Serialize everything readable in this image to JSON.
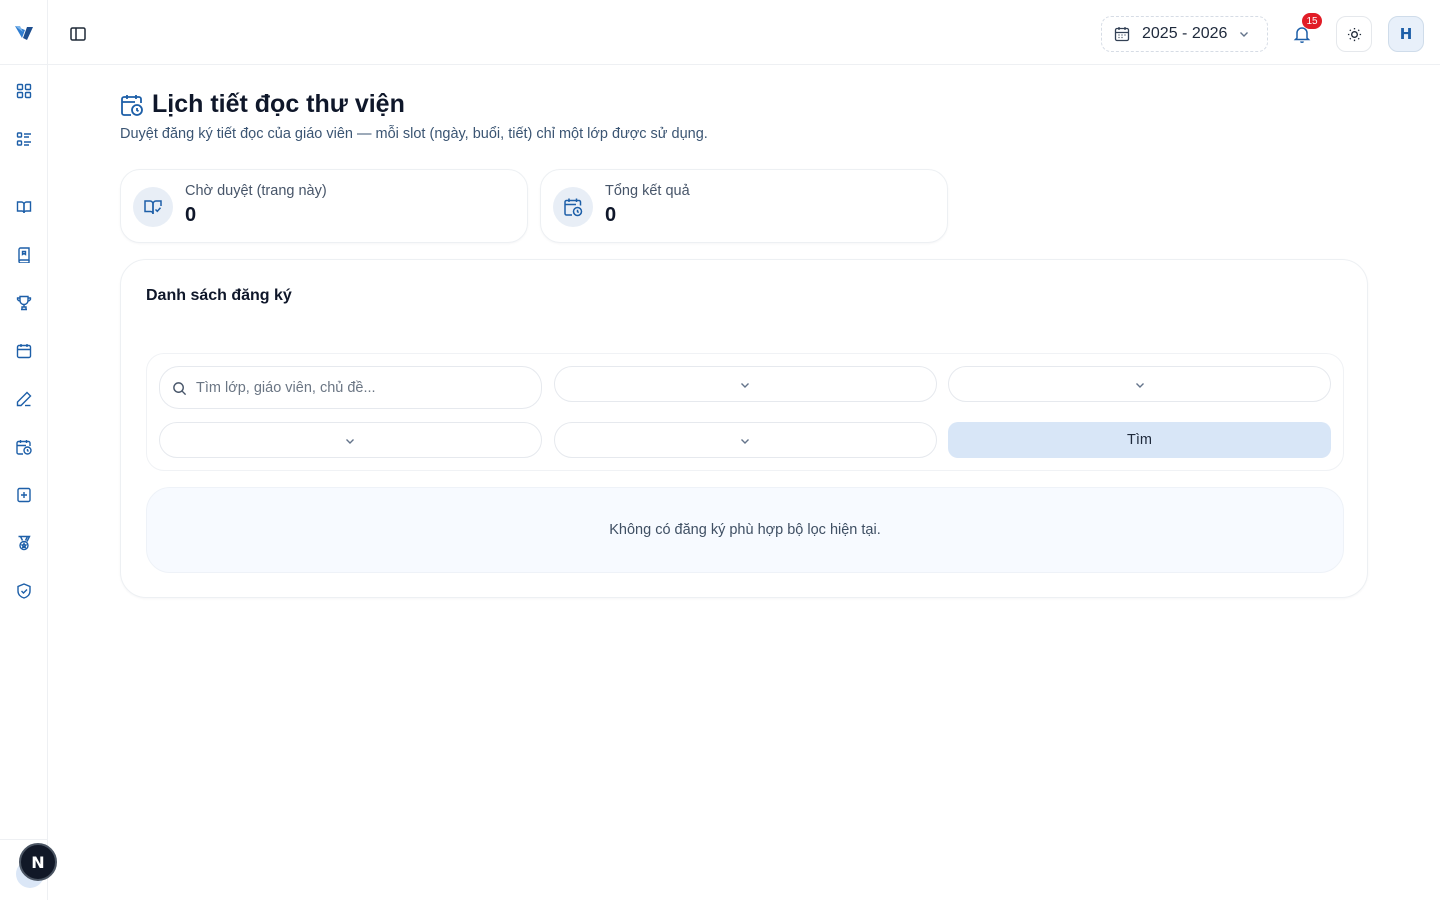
{
  "header": {
    "school_year": "2025 - 2026",
    "notification_count": "15",
    "user_initial": "H"
  },
  "page": {
    "title": "Lịch tiết đọc thư viện",
    "subtitle": "Duyệt đăng ký tiết đọc của giáo viên — mỗi slot (ngày, buổi, tiết) chỉ một lớp được sử dụng."
  },
  "stats": [
    {
      "label": "Chờ duyệt (trang này)",
      "value": "0",
      "icon": "book-check-icon"
    },
    {
      "label": "Tổng kết quả",
      "value": "0",
      "icon": "calendar-clock-icon"
    }
  ],
  "list": {
    "title": "Danh sách đăng ký",
    "search_placeholder": "Tìm lớp, giáo viên, chủ đề...",
    "search_button": "Tìm",
    "empty_message": "Không có đăng ký phù hợp bộ lọc hiện tại."
  },
  "sidebar": {
    "icons": [
      "dashboard-icon",
      "list-icon",
      "book-open-icon",
      "book-icon",
      "trophy-icon",
      "calendar-icon",
      "pen-icon",
      "calendar-clock-icon",
      "book-plus-icon",
      "medal-icon",
      "shield-check-icon"
    ]
  },
  "badge": {
    "letter": "N"
  },
  "colors": {
    "accent": "#1d5fa8",
    "notification": "#e11d27",
    "button_bg": "#d8e6f7"
  }
}
